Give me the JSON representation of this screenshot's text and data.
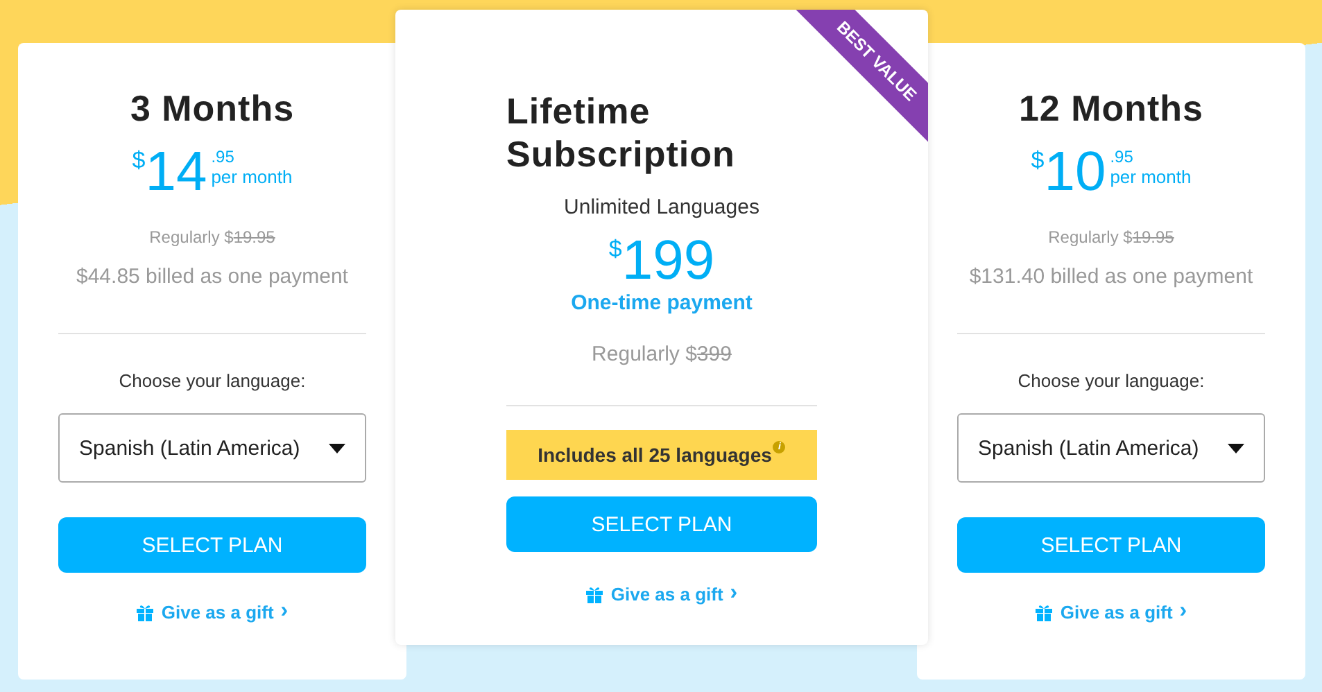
{
  "plans": [
    {
      "kind": "monthly",
      "title": "3 Months",
      "currency": "$",
      "price": "14",
      "cents": ".95",
      "period": "per month",
      "regular_prefix": "Regularly $",
      "regular_struck": "19.95",
      "billed": "$44.85 billed as one payment",
      "language_label": "Choose your language:",
      "language_value": "Spanish (Latin America)",
      "button": "SELECT PLAN",
      "gift": "Give as a gift",
      "gift_chevron": "›"
    },
    {
      "kind": "lifetime",
      "ribbon": "BEST VALUE",
      "title": "Lifetime Subscription",
      "subtitle": "Unlimited Languages",
      "currency": "$",
      "price": "199",
      "note": "One-time payment",
      "regular_prefix": "Regularly $",
      "regular_struck": "399",
      "includes": "Includes all 25 languages",
      "info_icon": "i",
      "button": "SELECT PLAN",
      "gift": "Give as a gift",
      "gift_chevron": "›"
    },
    {
      "kind": "monthly",
      "title": "12 Months",
      "currency": "$",
      "price": "10",
      "cents": ".95",
      "period": "per month",
      "regular_prefix": "Regularly $",
      "regular_struck": "19.95",
      "billed": "$131.40 billed as one payment",
      "language_label": "Choose your language:",
      "language_value": "Spanish (Latin America)",
      "button": "SELECT PLAN",
      "gift": "Give as a gift",
      "gift_chevron": "›"
    }
  ]
}
